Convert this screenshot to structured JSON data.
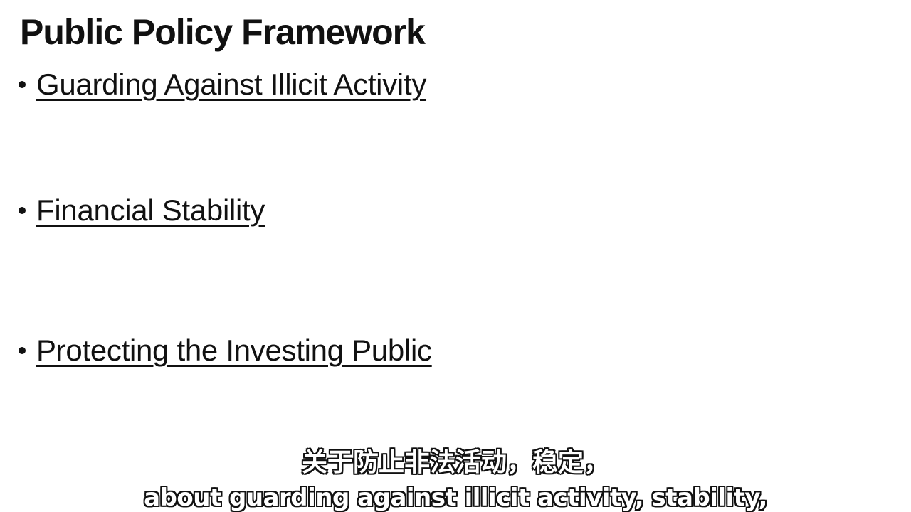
{
  "slide": {
    "title": "Public Policy Framework",
    "bullets": [
      "Guarding Against Illicit Activity",
      "Financial Stability",
      "Protecting the Investing Public"
    ]
  },
  "subtitles": {
    "chinese": "关于防止非法活动，稳定，",
    "english": "about guarding against illicit activity, stability,"
  }
}
